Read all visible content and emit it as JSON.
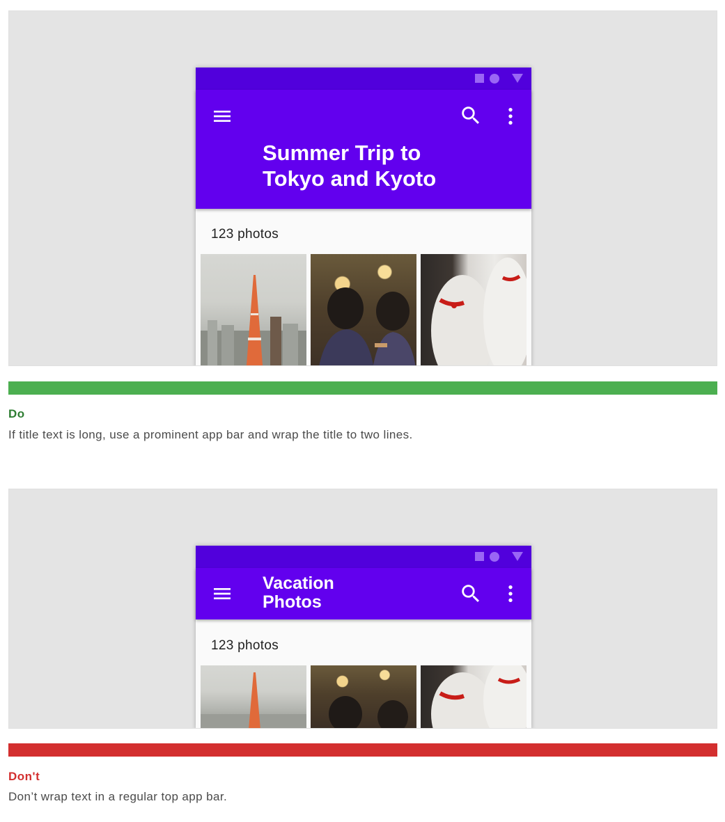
{
  "do_example": {
    "title_line1": "Summer Trip to",
    "title_line2": "Tokyo and Kyoto",
    "count": "123 photos"
  },
  "do_feedback": {
    "verdict": "Do",
    "caption": "If title text is long, use a prominent app bar and wrap the title to two lines.",
    "bar_color": "#4caf50",
    "verdict_color": "#2e7d32"
  },
  "dont_example": {
    "title_line1": "Vacation",
    "title_line2": "Photos",
    "count": "123 photos"
  },
  "dont_feedback": {
    "verdict": "Don't",
    "caption": "Don’t wrap text in a regular top app bar.",
    "bar_color": "#d32f2f",
    "verdict_color": "#d32f2f"
  },
  "colors": {
    "status_bar": "#5100dc",
    "app_bar": "#6200ee",
    "panel_bg": "#e4e4e4"
  },
  "icons": [
    "menu-icon",
    "search-icon",
    "more-vert-icon",
    "square-icon",
    "circle-icon",
    "triangle-icon"
  ]
}
